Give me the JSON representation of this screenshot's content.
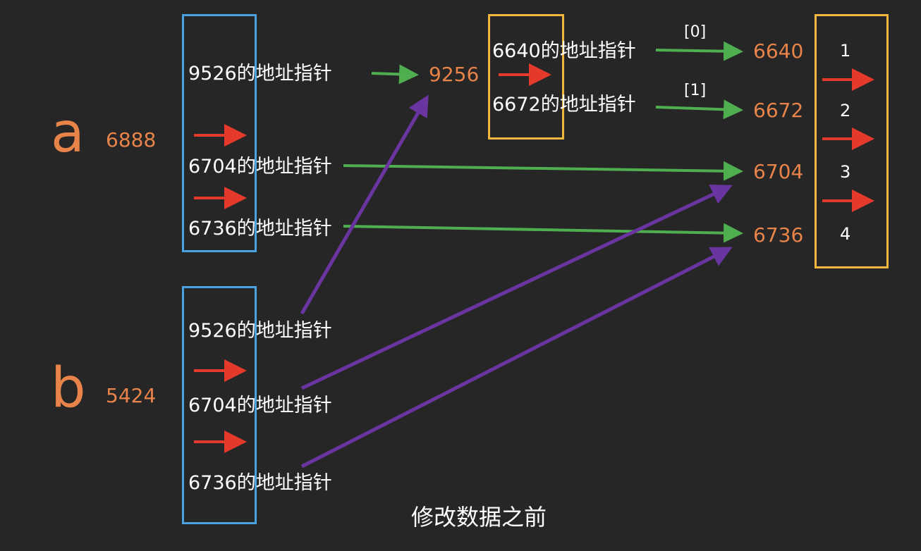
{
  "colors": {
    "background": "#262626",
    "orange": "#e8834a",
    "blue_box": "#4aa3e0",
    "yellow_box": "#f0b63e",
    "red_arrow": "#e4392b",
    "green_arrow": "#4fae4f",
    "purple_arrow": "#6a35a0"
  },
  "a": {
    "name": "a",
    "address": "6888",
    "cells": [
      "9526的地址指针",
      "6704的地址指针",
      "6736的地址指针"
    ]
  },
  "b": {
    "name": "b",
    "address": "5424",
    "cells": [
      "9526的地址指针",
      "6704的地址指针",
      "6736的地址指针"
    ]
  },
  "inner": {
    "address": "9256",
    "cells": [
      "6640的地址指针",
      "6672的地址指针"
    ],
    "index_labels": [
      "[0]",
      "[1]"
    ]
  },
  "targets": [
    "6640",
    "6672",
    "6704",
    "6736"
  ],
  "values": [
    "1",
    "2",
    "3",
    "4"
  ],
  "caption": "修改数据之前"
}
